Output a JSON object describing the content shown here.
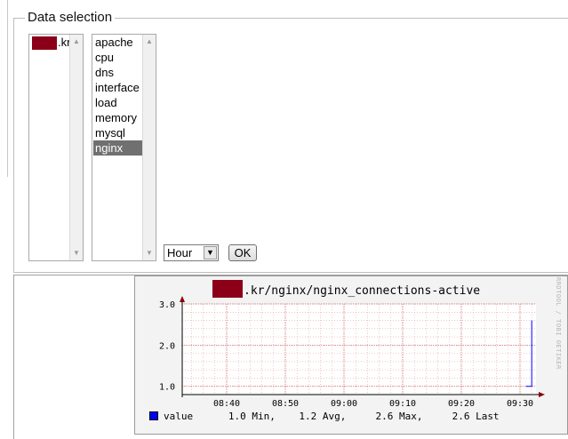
{
  "fieldset": {
    "legend": "Data selection"
  },
  "host_list": {
    "items": [
      {
        "label": ".kr",
        "selected": false
      }
    ]
  },
  "plugin_list": {
    "items": [
      "apache",
      "cpu",
      "dns",
      "interface",
      "load",
      "memory",
      "mysql",
      "nginx"
    ],
    "selected": "nginx"
  },
  "timespan": {
    "value": "Hour"
  },
  "ok_button": {
    "label": "OK"
  },
  "graph": {
    "title_suffix": ".kr/nginx/nginx_connections-active",
    "watermark": "RRDTOOL / TOBI OETIKER",
    "legend": {
      "series": "value",
      "min": "1.0 Min,",
      "avg": "1.2 Avg,",
      "max": "2.6 Max,",
      "last": "2.6 Last"
    }
  },
  "colors": {
    "line": "#0000ff",
    "grid": "#e8a0a0",
    "axis_arrow": "#8b0000",
    "redaction": "#8b0018",
    "selection": "#707070"
  },
  "chart_data": {
    "type": "line",
    "title": ".kr/nginx/nginx_connections-active",
    "xlabel": "",
    "ylabel": "",
    "x_ticks": [
      "08:40",
      "08:50",
      "09:00",
      "09:10",
      "09:20",
      "09:30"
    ],
    "y_ticks": [
      "1.0",
      "2.0",
      "3.0"
    ],
    "ylim": [
      0.8,
      3.0
    ],
    "grid": true,
    "series": [
      {
        "name": "value",
        "points": [
          {
            "x": "09:31",
            "y": 1.0
          },
          {
            "x": "09:32",
            "y": 1.0
          },
          {
            "x": "09:32",
            "y": 2.6
          }
        ]
      }
    ]
  }
}
